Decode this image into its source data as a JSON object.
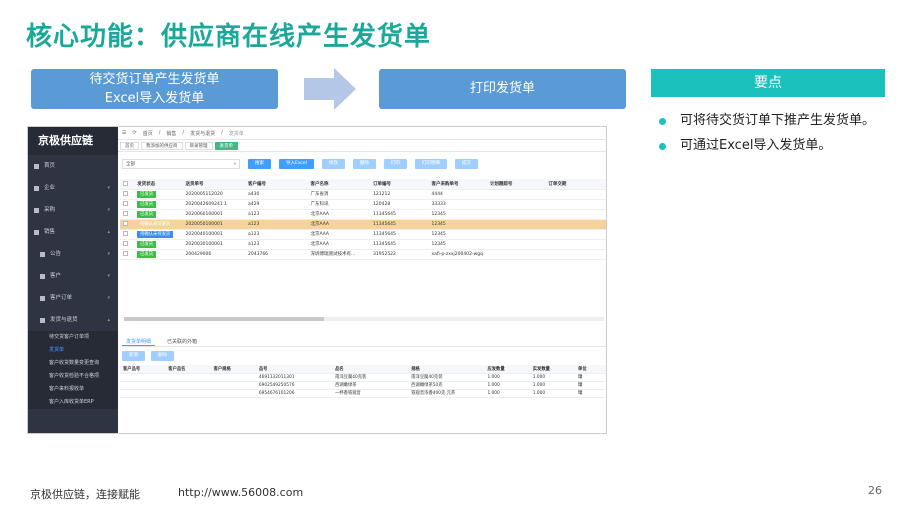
{
  "slide": {
    "title": "核心功能：供应商在线产生发货单",
    "flow": {
      "step1_line1": "待交货订单产生发货单",
      "step1_line2": "Excel导入发货单",
      "step2": "打印发货单"
    },
    "key_points": {
      "header": "要点",
      "items": [
        "可将待交货订单下推产生发货单。",
        "可通过Excel导入发货单。"
      ]
    },
    "footer": {
      "tagline": "京极供应链，连接赋能",
      "url": "http://www.56008.com",
      "page": "26"
    },
    "colors": {
      "title": "#1aa89a",
      "flow": "#5b9bd5",
      "accent": "#1bc1bd"
    }
  },
  "app": {
    "brand": "京极供应链",
    "nav": [
      {
        "label": "首页",
        "icon": "home-icon"
      },
      {
        "label": "企业",
        "icon": "grid-icon"
      },
      {
        "label": "采购",
        "icon": "grid-icon"
      },
      {
        "label": "销售",
        "icon": "grid-icon"
      },
      {
        "label": "公告",
        "icon": "grid-icon"
      },
      {
        "label": "客户",
        "icon": "grid-icon"
      },
      {
        "label": "客户订单",
        "icon": "grid-icon"
      },
      {
        "label": "发货与退货",
        "icon": "grid-icon"
      }
    ],
    "nav_leaves": [
      "待交货客户订单项",
      "发货单",
      "客户收货数量变更查询",
      "客户收货检验不合格项",
      "客户来料报收单",
      "客户入库收货单ERP"
    ],
    "breadcrumb": [
      "首页",
      "销售",
      "发货与退货",
      "发货单"
    ],
    "tabs": [
      "首页",
      "我添加的供应商",
      "目录管理",
      "发货单"
    ],
    "toolbar": {
      "select_value": "全部",
      "buttons": [
        "搜索",
        "导入Excel",
        "修改",
        "删除",
        "打印",
        "打印明细",
        "提交"
      ]
    },
    "table": {
      "headers": [
        "发货状态",
        "送货单号",
        "客户编号",
        "客户名称",
        "订单编号",
        "客户采购单号",
        "计划跟踪号",
        "订单交期"
      ],
      "rows": [
        {
          "status": "已发货",
          "status_color": "green",
          "no": "2020005112020",
          "cust_no": "a430",
          "cust_name": "广东省消",
          "order": "121212",
          "po": "4444",
          "plan": "",
          "due": ""
        },
        {
          "status": "已发货",
          "status_color": "green",
          "no": "2020042609241 1",
          "cust_no": "a429",
          "cust_name": "广东科讯",
          "order": "120428",
          "po": "33333",
          "plan": "",
          "due": ""
        },
        {
          "status": "已发货",
          "status_color": "green",
          "no": "2020060100001",
          "cust_no": "a123",
          "cust_name": "北京AAA",
          "order": "11345645",
          "po": "12345",
          "plan": "",
          "due": ""
        },
        {
          "status": "待确认未待发货",
          "status_color": "none",
          "no": "2020050100001",
          "cust_no": "a123",
          "cust_name": "北京AAA",
          "order": "11345645",
          "po": "12345",
          "plan": "",
          "due": "",
          "highlight": true
        },
        {
          "status": "待确认未待发货",
          "status_color": "blue",
          "no": "2020040100001",
          "cust_no": "a123",
          "cust_name": "北京AAA",
          "order": "11345645",
          "po": "12345",
          "plan": "",
          "due": ""
        },
        {
          "status": "已发货",
          "status_color": "green",
          "no": "2020030100001",
          "cust_no": "a123",
          "cust_name": "北京AAA",
          "order": "11345645",
          "po": "12345",
          "plan": "",
          "due": ""
        },
        {
          "status": "已发货",
          "status_color": "green",
          "no": "200429006",
          "cust_no": "2043766",
          "cust_name": "深圳博瑞测试技术有...",
          "order": "31952522",
          "po": "xafi-p-zxxj200402-wgq",
          "plan": "",
          "due": ""
        }
      ]
    },
    "lower": {
      "tabs": [
        "发货单明细",
        "已关联的外箱"
      ],
      "buttons": [
        "新增",
        "删除"
      ],
      "headers": [
        "客户品号",
        "客户品名",
        "客户规格",
        "品号",
        "品名",
        "规格",
        "应发数量",
        "实发数量",
        "单位"
      ],
      "rows": [
        {
          "c1": "",
          "c2": "",
          "c3": "",
          "no": "4691132011301",
          "name": "南洋豆腐40克装",
          "spec": "南洋豆腐40克装",
          "qty1": "1.000",
          "qty2": "1.000",
          "unit": "罐"
        },
        {
          "c1": "",
          "c2": "",
          "c3": "",
          "no": "6902549250576",
          "name": "西湖嫩绿茶",
          "spec": "西湖嫩绿茶50克",
          "qty1": "1.000",
          "qty2": "1.000",
          "unit": "罐"
        },
        {
          "c1": "",
          "c2": "",
          "c3": "",
          "no": "6954676101206",
          "name": "一杯香铁观音",
          "spec": "铁观音浓香400克 元茶",
          "qty1": "1.000",
          "qty2": "1.000",
          "unit": "罐"
        }
      ]
    }
  }
}
